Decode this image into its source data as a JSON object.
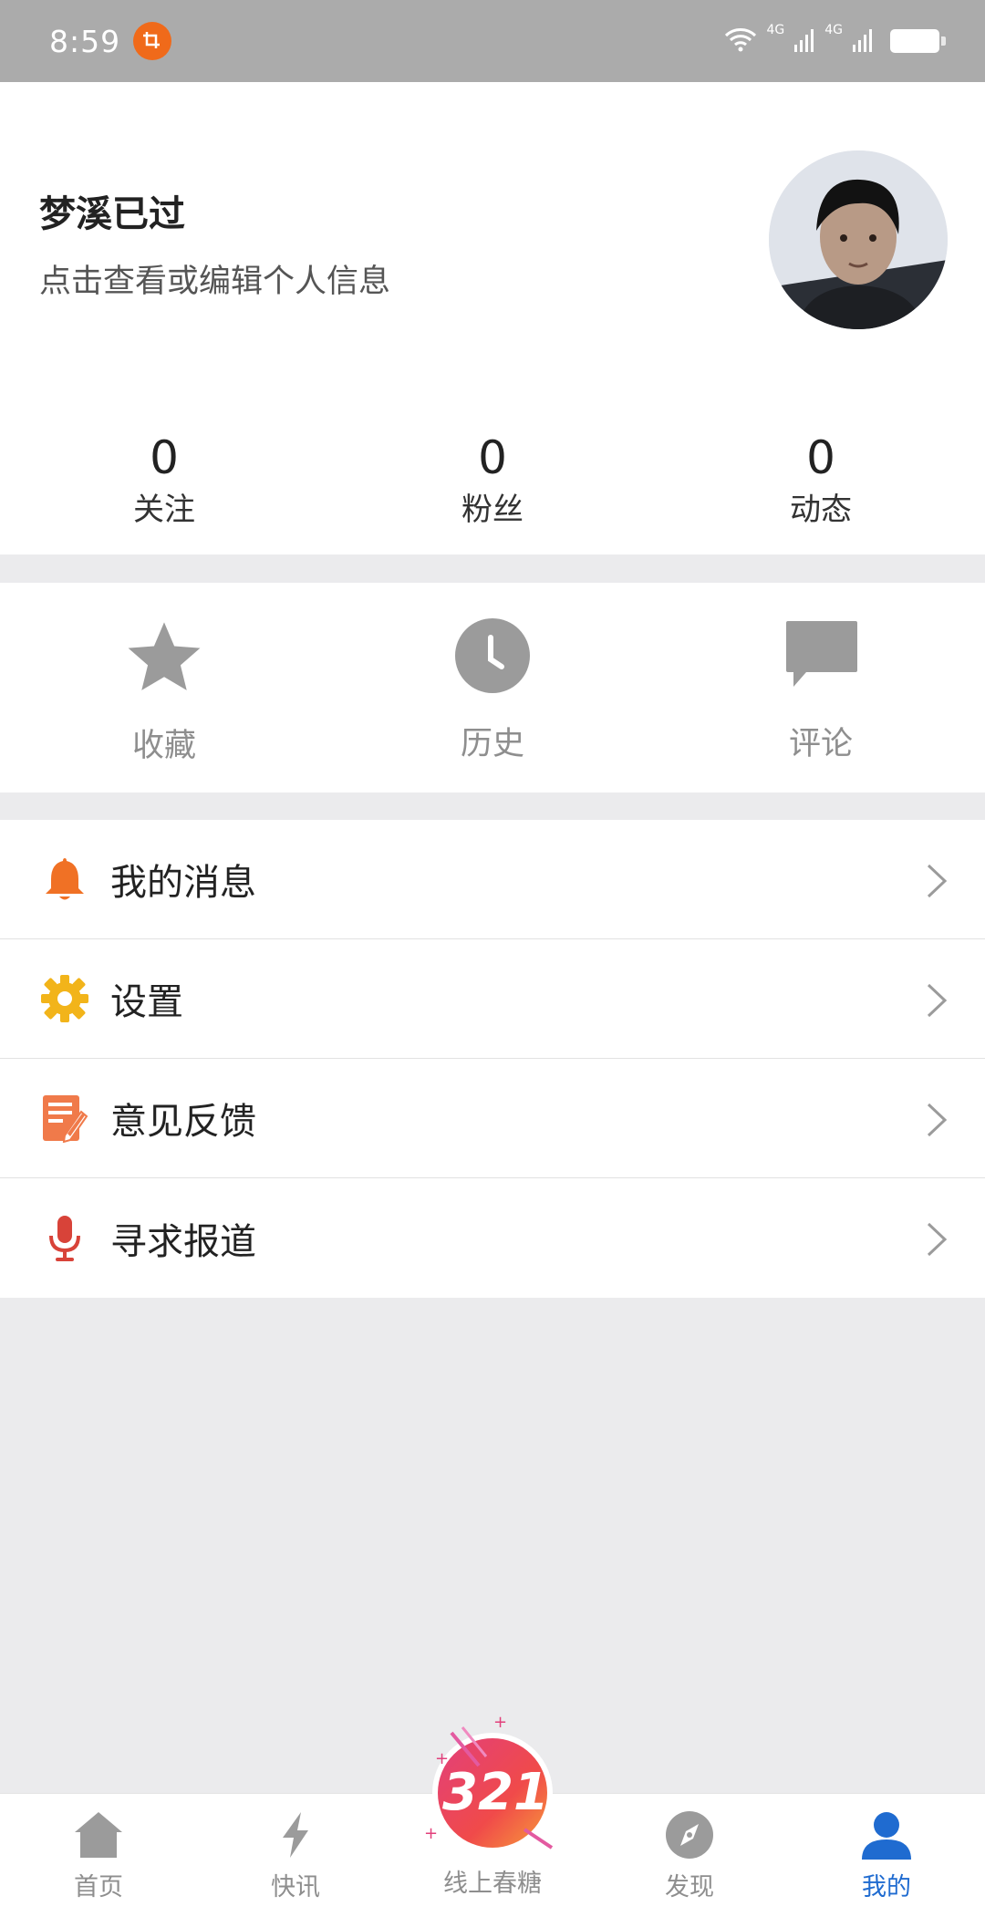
{
  "status": {
    "time": "8:59",
    "net1": "4G",
    "net2": "4G"
  },
  "profile": {
    "username": "梦溪已过",
    "hint": "点击查看或编辑个人信息"
  },
  "stats": [
    {
      "value": "0",
      "label": "关注"
    },
    {
      "value": "0",
      "label": "粉丝"
    },
    {
      "value": "0",
      "label": "动态"
    }
  ],
  "quick": [
    {
      "label": "收藏",
      "icon": "star-icon"
    },
    {
      "label": "历史",
      "icon": "clock-icon"
    },
    {
      "label": "评论",
      "icon": "comment-icon"
    }
  ],
  "menu": [
    {
      "label": "我的消息",
      "icon": "bell-icon",
      "color": "#f07125"
    },
    {
      "label": "设置",
      "icon": "gear-icon",
      "color": "#f2b41a"
    },
    {
      "label": "意见反馈",
      "icon": "feedback-icon",
      "color": "#f07a4a"
    },
    {
      "label": "寻求报道",
      "icon": "microphone-icon",
      "color": "#d84339"
    }
  ],
  "nav": [
    {
      "label": "首页",
      "icon": "home-icon"
    },
    {
      "label": "快讯",
      "icon": "lightning-icon"
    },
    {
      "label": "线上春糖",
      "icon": "321-badge-icon"
    },
    {
      "label": "发现",
      "icon": "compass-icon"
    },
    {
      "label": "我的",
      "icon": "person-icon",
      "active": true
    }
  ],
  "colors": {
    "accent": "#1f6bd0",
    "gray_icon": "#9b9b9b",
    "background": "#ebebed"
  }
}
